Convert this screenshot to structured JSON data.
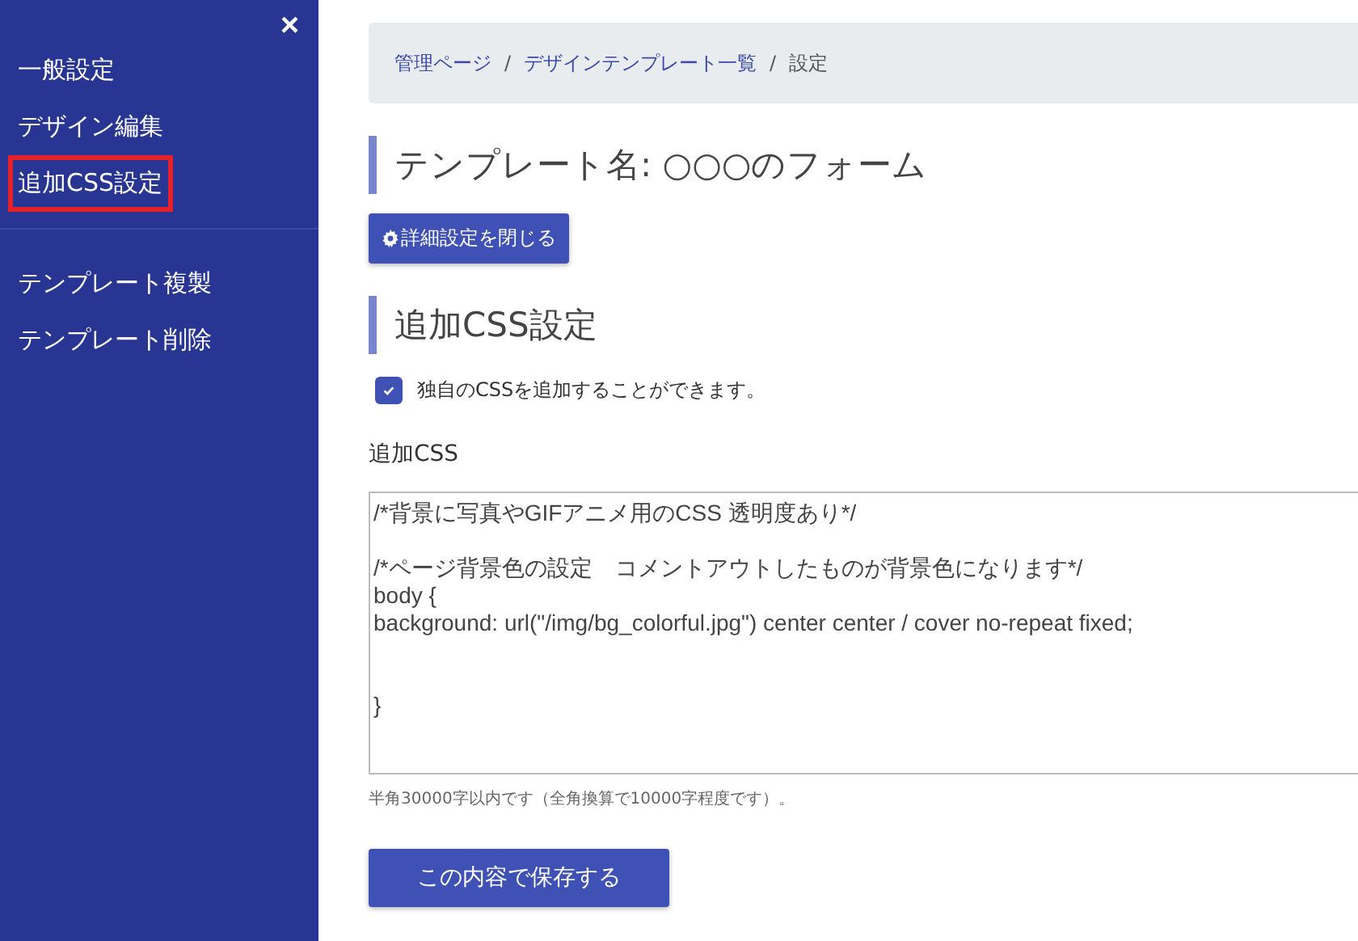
{
  "sidebar": {
    "close": "×",
    "groups": [
      {
        "items": [
          {
            "label": "一般設定",
            "selected": false
          },
          {
            "label": "デザイン編集",
            "selected": false
          },
          {
            "label": "追加CSS設定",
            "selected": true
          }
        ]
      },
      {
        "items": [
          {
            "label": "テンプレート複製",
            "selected": false
          },
          {
            "label": "テンプレート削除",
            "selected": false
          }
        ]
      }
    ]
  },
  "breadcrumb": [
    {
      "label": "管理ページ",
      "kind": "link"
    },
    {
      "label": "デザインテンプレート一覧",
      "kind": "link"
    },
    {
      "label": "設定",
      "kind": "current"
    }
  ],
  "separator": "/",
  "title": "テンプレート名: ○○○のフォーム",
  "details_button": "詳細設定を閉じる",
  "section_title": "追加CSS設定",
  "enable_checkbox": {
    "label": "独自のCSSを追加することができます。",
    "checked": true
  },
  "css_field": {
    "label": "追加CSS",
    "value": "/*背景に写真やGIFアニメ用のCSS 透明度あり*/\n\n/*ページ背景色の設定　コメントアウトしたものが背景色になります*/\nbody {\nbackground: url(\"/img/bg_colorful.jpg\") center center / cover no-repeat fixed;\n\n\n}",
    "hint": "半角30000字以内です（全角換算で10000字程度です）。"
  },
  "save_button": "この内容で保存する"
}
